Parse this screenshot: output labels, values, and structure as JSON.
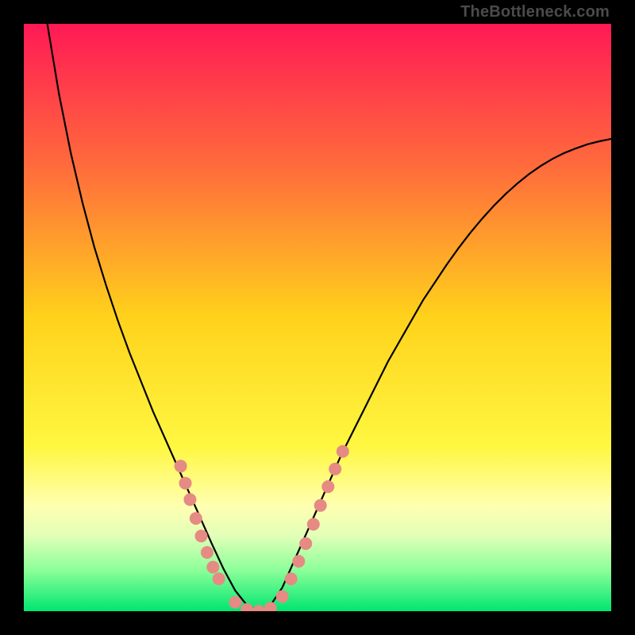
{
  "watermark": "TheBottleneck.com",
  "chart_data": {
    "type": "line",
    "title": "",
    "xlabel": "",
    "ylabel": "",
    "xlim": [
      0,
      1
    ],
    "ylim": [
      0,
      1
    ],
    "gradient_stops": [
      {
        "offset": 0.0,
        "color": "#ff1955"
      },
      {
        "offset": 0.25,
        "color": "#ff6e3b"
      },
      {
        "offset": 0.5,
        "color": "#ffd21b"
      },
      {
        "offset": 0.72,
        "color": "#fff741"
      },
      {
        "offset": 0.82,
        "color": "#ffffb0"
      },
      {
        "offset": 0.87,
        "color": "#e3ffb8"
      },
      {
        "offset": 0.93,
        "color": "#8cff9a"
      },
      {
        "offset": 1.0,
        "color": "#00e670"
      }
    ],
    "series": [
      {
        "name": "curve",
        "x": [
          0.04,
          0.06,
          0.08,
          0.1,
          0.12,
          0.14,
          0.16,
          0.18,
          0.2,
          0.22,
          0.24,
          0.26,
          0.28,
          0.3,
          0.32,
          0.34,
          0.36,
          0.38,
          0.4,
          0.42,
          0.44,
          0.46,
          0.48,
          0.5,
          0.52,
          0.54,
          0.56,
          0.58,
          0.6,
          0.62,
          0.64,
          0.66,
          0.68,
          0.7,
          0.72,
          0.74,
          0.76,
          0.78,
          0.8,
          0.82,
          0.84,
          0.86,
          0.88,
          0.9,
          0.92,
          0.94,
          0.96,
          0.98,
          1.0
        ],
        "values": [
          1.0,
          0.88,
          0.78,
          0.695,
          0.62,
          0.555,
          0.495,
          0.44,
          0.39,
          0.34,
          0.295,
          0.25,
          0.205,
          0.16,
          0.115,
          0.072,
          0.035,
          0.01,
          0.0,
          0.01,
          0.04,
          0.085,
          0.13,
          0.175,
          0.22,
          0.265,
          0.305,
          0.345,
          0.385,
          0.425,
          0.46,
          0.495,
          0.53,
          0.56,
          0.59,
          0.618,
          0.644,
          0.668,
          0.69,
          0.71,
          0.728,
          0.744,
          0.758,
          0.77,
          0.78,
          0.788,
          0.795,
          0.8,
          0.804
        ]
      }
    ],
    "salmon_dot_clusters": [
      {
        "x_range": [
          0.26,
          0.34
        ],
        "y_range": [
          0.07,
          0.3
        ]
      },
      {
        "x_range": [
          0.42,
          0.56
        ],
        "y_range": [
          0.0,
          0.27
        ]
      }
    ],
    "salmon_dots_xy": [
      [
        0.267,
        0.247
      ],
      [
        0.275,
        0.218
      ],
      [
        0.283,
        0.19
      ],
      [
        0.293,
        0.158
      ],
      [
        0.302,
        0.128
      ],
      [
        0.312,
        0.1
      ],
      [
        0.322,
        0.075
      ],
      [
        0.332,
        0.055
      ],
      [
        0.36,
        0.015
      ],
      [
        0.38,
        0.003
      ],
      [
        0.4,
        0.0
      ],
      [
        0.42,
        0.005
      ],
      [
        0.44,
        0.025
      ],
      [
        0.455,
        0.055
      ],
      [
        0.468,
        0.085
      ],
      [
        0.48,
        0.115
      ],
      [
        0.493,
        0.148
      ],
      [
        0.505,
        0.18
      ],
      [
        0.518,
        0.212
      ],
      [
        0.53,
        0.242
      ],
      [
        0.543,
        0.272
      ]
    ]
  }
}
